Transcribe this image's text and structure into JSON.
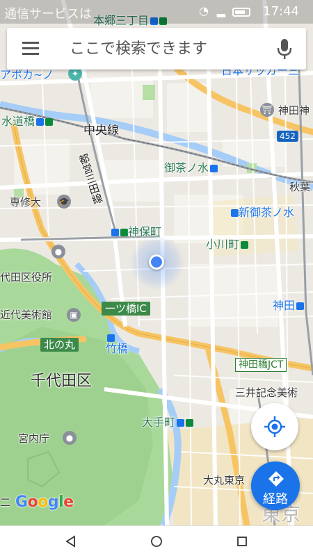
{
  "status_bar": {
    "carrier": "通信サービスは",
    "time": "17:44"
  },
  "search": {
    "placeholder": "ここで検索できます",
    "menu_icon": "hamburger-menu-icon",
    "mic_icon": "microphone-icon"
  },
  "map": {
    "labels": {
      "hongo": "本郷三丁目",
      "apo": "アポカ~ノ",
      "nihon_soccer": "日本サッカー三",
      "kanda_top": "神田神",
      "suidobashi": "水道橋",
      "chuo_line": "中央線",
      "toei_mita": "都営三田線",
      "ochanomizu": "御茶ノ水",
      "akiba": "秋葉",
      "senshu": "専修大",
      "shin_ochanomizu": "新御茶ノ水",
      "jimbocho": "神保町",
      "ogawamachi": "小川町",
      "chiyoda_office": "代田区役所",
      "museum": "近代美術館",
      "kanda": "神田",
      "hitotsubashi_ic": "一ツ橋IC",
      "kitanomaru": "北の丸",
      "takebashi": "竹橋",
      "kanda_jct": "神田橋JCT",
      "chiyoda_ku": "千代田区",
      "mitsui": "三井記念美術",
      "otemachi": "大手町",
      "kunaicho": "宮内庁",
      "daimaru": "大丸東京",
      "tokyo": "東京",
      "ni": "二",
      "route_452": "452"
    },
    "logo": "Google"
  },
  "fab": {
    "locate_icon": "my-location-icon",
    "route_label": "経路",
    "route_icon": "directions-icon"
  },
  "nav": {
    "back_icon": "back-triangle-icon",
    "home_icon": "home-circle-icon",
    "recents_icon": "recents-square-icon"
  },
  "colors": {
    "accent": "#1a73e8",
    "location_dot": "#4285f4",
    "park": "#a8d99a",
    "water": "#a5cdf7",
    "highway": "#f7c463"
  }
}
